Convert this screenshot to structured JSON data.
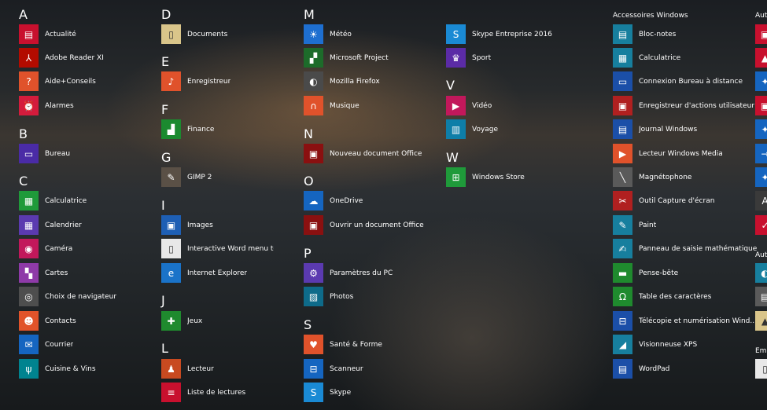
{
  "columns": [
    {
      "sections": [
        {
          "letter": "A",
          "items": [
            {
              "label": "Actualité",
              "color": "#c8102e",
              "icon": "news-icon",
              "glyph": "▤"
            },
            {
              "label": "Adobe Reader XI",
              "color": "#b30b00",
              "icon": "adobe-reader-icon",
              "glyph": "⅄"
            },
            {
              "label": "Aide+Conseils",
              "color": "#e0522b",
              "icon": "help-icon",
              "glyph": "?"
            },
            {
              "label": "Alarmes",
              "color": "#d41c3c",
              "icon": "alarm-clock-icon",
              "glyph": "⏰"
            }
          ]
        },
        {
          "letter": "B",
          "items": [
            {
              "label": "Bureau",
              "color": "#4a2ba6",
              "icon": "desktop-icon",
              "glyph": "▭"
            }
          ]
        },
        {
          "letter": "C",
          "items": [
            {
              "label": "Calculatrice",
              "color": "#1f9a3a",
              "icon": "calculator-icon",
              "glyph": "▦"
            },
            {
              "label": "Calendrier",
              "color": "#5b3ab0",
              "icon": "calendar-icon",
              "glyph": "▦"
            },
            {
              "label": "Caméra",
              "color": "#c2185b",
              "icon": "camera-icon",
              "glyph": "◉"
            },
            {
              "label": "Cartes",
              "color": "#8e3aa8",
              "icon": "maps-icon",
              "glyph": "▚"
            },
            {
              "label": "Choix de navigateur",
              "color": "#4e4e4e",
              "icon": "globe-icon",
              "glyph": "◎"
            },
            {
              "label": "Contacts",
              "color": "#e1532a",
              "icon": "contacts-icon",
              "glyph": "☻"
            },
            {
              "label": "Courrier",
              "color": "#1565c0",
              "icon": "mail-icon",
              "glyph": "✉"
            },
            {
              "label": "Cuisine & Vins",
              "color": "#00838f",
              "icon": "food-icon",
              "glyph": "ψ"
            }
          ]
        }
      ]
    },
    {
      "sections": [
        {
          "letter": "D",
          "items": [
            {
              "label": "Documents",
              "color": "#d9c58a",
              "icon": "documents-folder-icon",
              "glyph": "▯"
            }
          ]
        },
        {
          "letter": "E",
          "items": [
            {
              "label": "Enregistreur",
              "color": "#e0522b",
              "icon": "microphone-icon",
              "glyph": "♪"
            }
          ]
        },
        {
          "letter": "F",
          "items": [
            {
              "label": "Finance",
              "color": "#1b8a2f",
              "icon": "finance-chart-icon",
              "glyph": "▟"
            }
          ]
        },
        {
          "letter": "G",
          "items": [
            {
              "label": "GIMP 2",
              "color": "#5a5046",
              "icon": "gimp-icon",
              "glyph": "✎"
            }
          ]
        },
        {
          "letter": "I",
          "items": [
            {
              "label": "Images",
              "color": "#1e5fb4",
              "icon": "images-folder-icon",
              "glyph": "▣"
            },
            {
              "label": "Interactive Word menu to ri",
              "color": "#e8e8e8",
              "icon": "document-icon",
              "glyph": "▯"
            },
            {
              "label": "Internet Explorer",
              "color": "#1a73c9",
              "icon": "internet-explorer-icon",
              "glyph": "e"
            }
          ]
        },
        {
          "letter": "J",
          "items": [
            {
              "label": "Jeux",
              "color": "#1f8a2e",
              "icon": "games-controller-icon",
              "glyph": "✚"
            }
          ]
        },
        {
          "letter": "L",
          "items": [
            {
              "label": "Lecteur",
              "color": "#c84a20",
              "icon": "reader-icon",
              "glyph": "♟"
            },
            {
              "label": "Liste de lectures",
              "color": "#c8102e",
              "icon": "reading-list-icon",
              "glyph": "≡"
            }
          ]
        }
      ]
    },
    {
      "sections": [
        {
          "letter": "M",
          "items": [
            {
              "label": "Météo",
              "color": "#1e6fd0",
              "icon": "weather-sun-icon",
              "glyph": "☀"
            },
            {
              "label": "Microsoft Project",
              "color": "#1d6b2a",
              "icon": "project-icon",
              "glyph": "▞"
            },
            {
              "label": "Mozilla Firefox",
              "color": "#4a4a4a",
              "icon": "firefox-icon",
              "glyph": "◐"
            },
            {
              "label": "Musique",
              "color": "#e0522b",
              "icon": "headphones-icon",
              "glyph": "∩"
            }
          ]
        },
        {
          "letter": "N",
          "items": [
            {
              "label": "Nouveau document Office",
              "color": "#8a1010",
              "icon": "new-office-document-icon",
              "glyph": "▣"
            }
          ]
        },
        {
          "letter": "O",
          "items": [
            {
              "label": "OneDrive",
              "color": "#1565c0",
              "icon": "cloud-icon",
              "glyph": "☁"
            },
            {
              "label": "Ouvrir un document Office",
              "color": "#8a1010",
              "icon": "open-office-document-icon",
              "glyph": "▣"
            }
          ]
        },
        {
          "letter": "P",
          "items": [
            {
              "label": "Paramètres du PC",
              "color": "#5b3ab0",
              "icon": "gear-icon",
              "glyph": "⚙"
            },
            {
              "label": "Photos",
              "color": "#0e6b8a",
              "icon": "photos-icon",
              "glyph": "▨"
            }
          ]
        },
        {
          "letter": "S",
          "items": [
            {
              "label": "Santé & Forme",
              "color": "#e0522b",
              "icon": "heart-icon",
              "glyph": "♥"
            },
            {
              "label": "Scanneur",
              "color": "#1565c0",
              "icon": "scanner-icon",
              "glyph": "⊟"
            },
            {
              "label": "Skype",
              "color": "#1a8ad4",
              "icon": "skype-icon",
              "glyph": "S"
            }
          ]
        }
      ]
    },
    {
      "sections": [
        {
          "letter": "",
          "items": [
            {
              "label": "Skype Entreprise 2016",
              "color": "#1a8ad4",
              "icon": "skype-business-icon",
              "glyph": "S"
            },
            {
              "label": "Sport",
              "color": "#5b2ba6",
              "icon": "trophy-icon",
              "glyph": "♛"
            }
          ]
        },
        {
          "letter": "V",
          "items": [
            {
              "label": "Vidéo",
              "color": "#c2185b",
              "icon": "video-icon",
              "glyph": "▶"
            },
            {
              "label": "Voyage",
              "color": "#0e7ea8",
              "icon": "suitcase-icon",
              "glyph": "▥"
            }
          ]
        },
        {
          "letter": "W",
          "items": [
            {
              "label": "Windows Store",
              "color": "#1f9a3a",
              "icon": "store-bag-icon",
              "glyph": "⊞"
            }
          ]
        }
      ]
    },
    {
      "group": "Accessoires Windows",
      "items": [
        {
          "label": "Bloc-notes",
          "color": "#177f9e",
          "icon": "notepad-icon",
          "glyph": "▤"
        },
        {
          "label": "Calculatrice",
          "color": "#177f9e",
          "icon": "calculator-icon",
          "glyph": "▦"
        },
        {
          "label": "Connexion Bureau à distance",
          "color": "#1b4fa8",
          "icon": "remote-desktop-icon",
          "glyph": "▭"
        },
        {
          "label": "Enregistreur d'actions utilisateur",
          "color": "#b02020",
          "icon": "steps-recorder-icon",
          "glyph": "▣"
        },
        {
          "label": "Journal Windows",
          "color": "#1b4fa8",
          "icon": "journal-icon",
          "glyph": "▤"
        },
        {
          "label": "Lecteur Windows Media",
          "color": "#e0522b",
          "icon": "media-player-icon",
          "glyph": "▶"
        },
        {
          "label": "Magnétophone",
          "color": "#5a5a5a",
          "icon": "sound-recorder-icon",
          "glyph": "╲"
        },
        {
          "label": "Outil Capture d'écran",
          "color": "#b02020",
          "icon": "snipping-tool-icon",
          "glyph": "✂"
        },
        {
          "label": "Paint",
          "color": "#177f9e",
          "icon": "paint-palette-icon",
          "glyph": "✎"
        },
        {
          "label": "Panneau de saisie mathématique",
          "color": "#177f9e",
          "icon": "math-input-icon",
          "glyph": "✍"
        },
        {
          "label": "Pense-bête",
          "color": "#1f8a2e",
          "icon": "sticky-notes-icon",
          "glyph": "▬"
        },
        {
          "label": "Table des caractères",
          "color": "#1f8a2e",
          "icon": "character-map-icon",
          "glyph": "Ω"
        },
        {
          "label": "Télécopie et numérisation Wind...",
          "color": "#1b4fa8",
          "icon": "fax-scan-icon",
          "glyph": "⊟"
        },
        {
          "label": "Visionneuse XPS",
          "color": "#177f9e",
          "icon": "xps-viewer-icon",
          "glyph": "◢"
        },
        {
          "label": "WordPad",
          "color": "#1b4fa8",
          "icon": "wordpad-icon",
          "glyph": "▤"
        }
      ]
    },
    {
      "groups": [
        "Auto",
        "Auto",
        "Emb"
      ],
      "tiles": [
        {
          "color": "#c8102e",
          "icon": "partial-app-icon",
          "glyph": "▣"
        },
        {
          "color": "#c8102e",
          "icon": "partial-app-icon",
          "glyph": "▲"
        },
        {
          "color": "#1565c0",
          "icon": "partial-tool-icon",
          "glyph": "✦"
        },
        {
          "color": "#c8102e",
          "icon": "partial-app-icon",
          "glyph": "▣"
        },
        {
          "color": "#1565c0",
          "icon": "partial-tool-icon",
          "glyph": "✦"
        },
        {
          "color": "#1565c0",
          "icon": "partial-arrow-icon",
          "glyph": "→"
        },
        {
          "color": "#1565c0",
          "icon": "partial-tool-icon",
          "glyph": "✦"
        },
        {
          "color": "#3a3a3a",
          "icon": "partial-font-icon",
          "glyph": "A"
        },
        {
          "color": "#c8102e",
          "icon": "partial-check-icon",
          "glyph": "✓"
        },
        {
          "color": "#177f9e",
          "icon": "partial-app-icon",
          "glyph": "◐"
        },
        {
          "color": "#5a5a5a",
          "icon": "partial-app-icon",
          "glyph": "▤"
        },
        {
          "color": "#d9c58a",
          "icon": "partial-app-icon",
          "glyph": "▲"
        },
        {
          "color": "#e8e8e8",
          "icon": "partial-app-icon",
          "glyph": "▯"
        }
      ]
    }
  ]
}
